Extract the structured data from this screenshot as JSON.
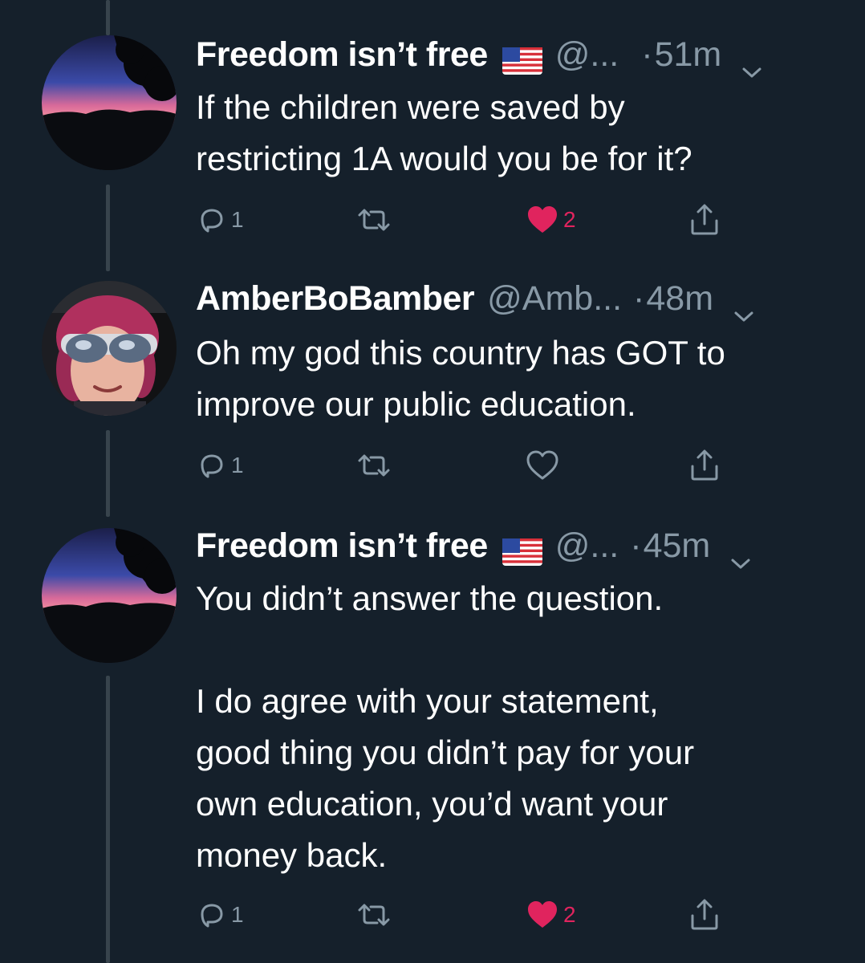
{
  "tweets": [
    {
      "display_name": "Freedom isn’t free",
      "flag_icon": "us-flag-icon",
      "handle": "@...",
      "separator": "·",
      "time": "51m",
      "text_lines": [
        "If the children were saved by",
        "restricting 1A would you be for it?"
      ],
      "reply_count": "1",
      "like_count": "2",
      "liked": true
    },
    {
      "display_name": "AmberBoBamber",
      "handle": "@Amb...",
      "separator": "·",
      "time": "48m",
      "text_lines": [
        "Oh my god this country has GOT to",
        "improve our public education."
      ],
      "reply_count": "1",
      "like_count": "",
      "liked": false
    },
    {
      "display_name": "Freedom isn’t free",
      "flag_icon": "us-flag-icon",
      "handle": "@...",
      "separator": "·",
      "time": "45m",
      "text_lines": [
        "You didn’t answer the question."
      ],
      "text_lines_2": [
        "I do agree with your statement,",
        "good thing you didn’t pay for your",
        "own education, you’d want your",
        "money back."
      ],
      "reply_count": "1",
      "like_count": "2",
      "liked": true
    }
  ],
  "colors": {
    "background": "#15202b",
    "secondary_text": "#8899a6",
    "thread_line": "#38444d",
    "like_red": "#e0245e"
  }
}
